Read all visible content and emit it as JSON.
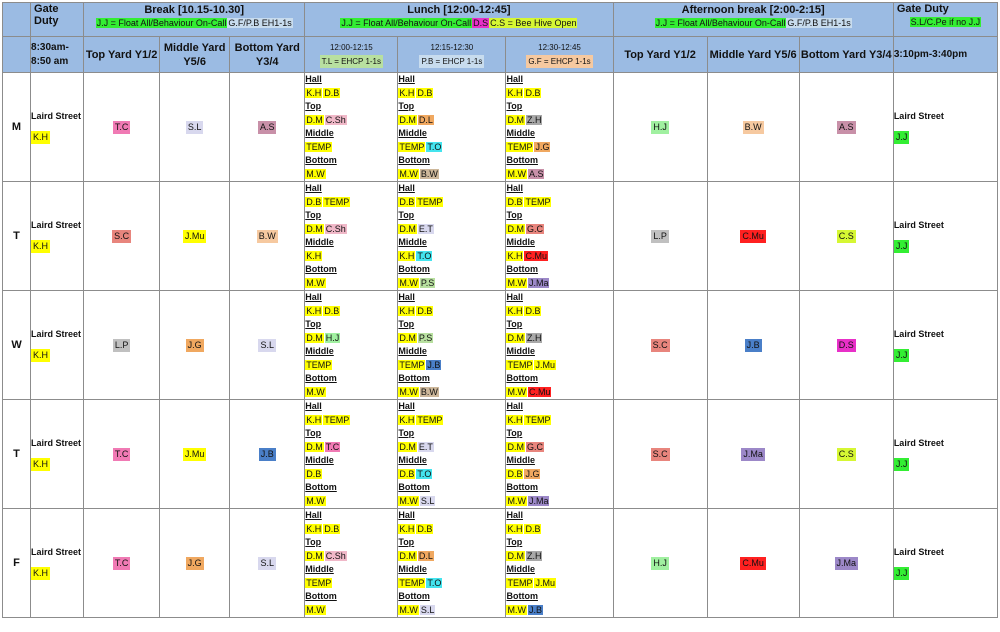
{
  "header": {
    "gate_duty_left": "Gate Duty",
    "break_title": "Break [10.15-10.30]",
    "break_notes": [
      {
        "text": "J.J = Float All/Behaviour On-Call",
        "color": "green"
      },
      {
        "text": "G.F/P.B EH1-1s",
        "color": "lblue"
      }
    ],
    "lunch_title": "Lunch [12:00-12:45]",
    "lunch_notes": [
      {
        "text": "J.J = Float All/Behaviour On-Call",
        "color": "green"
      },
      {
        "text": "D.S",
        "color": "magenta"
      },
      {
        "text": "C.S = Bee Hive Open",
        "color": "lime"
      }
    ],
    "afternoon_title": "Afternoon break [2:00-2:15]",
    "afternoon_notes": [
      {
        "text": "J.J = Float All/Behaviour On-Call",
        "color": "green"
      },
      {
        "text": "G.F/P.B EH1-1s",
        "color": "lblue"
      }
    ],
    "gate_duty_right": "Gate Duty",
    "gate_right_note": {
      "text": "S.L/C.Pe if no J.J",
      "color": "green"
    }
  },
  "subheader": {
    "morning_time": "8:30am-8:50 am",
    "break_yards": [
      "Top Yard Y1/2",
      "Middle Yard Y5/6",
      "Bottom Yard Y3/4"
    ],
    "lunch_slots": [
      {
        "time": "12:00-12:15",
        "note": "T.L = EHCP 1-1s",
        "color": "green2"
      },
      {
        "time": "12:15-12:30",
        "note": "P.B = EHCP 1-1s",
        "color": "lblue"
      },
      {
        "time": "12:30-12:45",
        "note": "G.F = EHCP 1-1s",
        "color": "peach"
      }
    ],
    "afternoon_yards": [
      "Top Yard Y1/2",
      "Middle Yard Y5/6",
      "Bottom Yard Y3/4"
    ],
    "afternoon_time": "3:10pm-3:40pm"
  },
  "days": [
    {
      "label": "M",
      "gate_am": {
        "place": "Laird Street",
        "staff": "K.H"
      },
      "break": [
        {
          "t": "T.C",
          "c": "pink"
        },
        {
          "t": "S.L",
          "c": "lav"
        },
        {
          "t": "A.S",
          "c": "mauve"
        }
      ],
      "lunch": [
        {
          "hall": [
            {
              "t": "K.H",
              "c": "yellow"
            },
            {
              "t": "D.B",
              "c": "yellow"
            }
          ],
          "top": [
            {
              "t": "D.M",
              "c": "yellow"
            },
            {
              "t": "C.Sh",
              "c": "rose"
            }
          ],
          "middle": [
            {
              "t": "TEMP",
              "c": "yellow"
            }
          ],
          "bottom": [
            {
              "t": "M.W",
              "c": "yellow"
            }
          ]
        },
        {
          "hall": [
            {
              "t": "K.H",
              "c": "yellow"
            },
            {
              "t": "D.B",
              "c": "yellow"
            }
          ],
          "top": [
            {
              "t": "D.M",
              "c": "yellow"
            },
            {
              "t": "D.L",
              "c": "orange"
            }
          ],
          "middle": [
            {
              "t": "TEMP",
              "c": "yellow"
            },
            {
              "t": "T.O",
              "c": "cyan"
            }
          ],
          "bottom": [
            {
              "t": "M.W",
              "c": "yellow"
            },
            {
              "t": "B.W",
              "c": "tan"
            }
          ]
        },
        {
          "hall": [
            {
              "t": "K.H",
              "c": "yellow"
            },
            {
              "t": "D.B",
              "c": "yellow"
            }
          ],
          "top": [
            {
              "t": "D.M",
              "c": "yellow"
            },
            {
              "t": "Z.H",
              "c": "dgray"
            }
          ],
          "middle": [
            {
              "t": "TEMP",
              "c": "yellow"
            },
            {
              "t": "J.G",
              "c": "orange"
            }
          ],
          "bottom": [
            {
              "t": "M.W",
              "c": "yellow"
            },
            {
              "t": "A.S",
              "c": "mauve"
            }
          ]
        }
      ],
      "afternoon": [
        {
          "t": "H.J",
          "c": "lightgreen"
        },
        {
          "t": "B.W",
          "c": "peach"
        },
        {
          "t": "A.S",
          "c": "mauve"
        }
      ],
      "gate_pm": {
        "place": "Laird Street",
        "staff": "J.J"
      }
    },
    {
      "label": "T",
      "gate_am": {
        "place": "Laird Street",
        "staff": "K.H"
      },
      "break": [
        {
          "t": "S.C",
          "c": "salmon"
        },
        {
          "t": "J.Mu",
          "c": "yellow"
        },
        {
          "t": "B.W",
          "c": "peach"
        }
      ],
      "lunch": [
        {
          "hall": [
            {
              "t": "D.B",
              "c": "yellow"
            },
            {
              "t": "TEMP",
              "c": "yellow"
            }
          ],
          "top": [
            {
              "t": "D.M",
              "c": "yellow"
            },
            {
              "t": "C.Sh",
              "c": "rose"
            }
          ],
          "middle": [
            {
              "t": "K.H",
              "c": "yellow"
            }
          ],
          "bottom": [
            {
              "t": "M.W",
              "c": "yellow"
            }
          ]
        },
        {
          "hall": [
            {
              "t": "D.B",
              "c": "yellow"
            },
            {
              "t": "TEMP",
              "c": "yellow"
            }
          ],
          "top": [
            {
              "t": "D.M",
              "c": "yellow"
            },
            {
              "t": "E.T",
              "c": "lav"
            }
          ],
          "middle": [
            {
              "t": "K.H",
              "c": "yellow"
            },
            {
              "t": "T.O",
              "c": "cyan"
            }
          ],
          "bottom": [
            {
              "t": "M.W",
              "c": "yellow"
            },
            {
              "t": "P.S",
              "c": "green2"
            }
          ]
        },
        {
          "hall": [
            {
              "t": "D.B",
              "c": "yellow"
            },
            {
              "t": "TEMP",
              "c": "yellow"
            }
          ],
          "top": [
            {
              "t": "D.M",
              "c": "yellow"
            },
            {
              "t": "G.C",
              "c": "salmon"
            }
          ],
          "middle": [
            {
              "t": "K.H",
              "c": "yellow"
            },
            {
              "t": "C.Mu",
              "c": "red"
            }
          ],
          "bottom": [
            {
              "t": "M.W",
              "c": "yellow"
            },
            {
              "t": "J.Ma",
              "c": "purple"
            }
          ]
        }
      ],
      "afternoon": [
        {
          "t": "L.P",
          "c": "gray"
        },
        {
          "t": "C.Mu",
          "c": "red"
        },
        {
          "t": "C.S",
          "c": "lime"
        }
      ],
      "gate_pm": {
        "place": "Laird Street",
        "staff": "J.J"
      }
    },
    {
      "label": "W",
      "gate_am": {
        "place": "Laird Street",
        "staff": "K.H"
      },
      "break": [
        {
          "t": "L.P",
          "c": "gray"
        },
        {
          "t": "J.G",
          "c": "orange"
        },
        {
          "t": "S.L",
          "c": "lav"
        }
      ],
      "lunch": [
        {
          "hall": [
            {
              "t": "K.H",
              "c": "yellow"
            },
            {
              "t": "D.B",
              "c": "yellow"
            }
          ],
          "top": [
            {
              "t": "D.M",
              "c": "yellow"
            },
            {
              "t": "H.J",
              "c": "lightgreen"
            }
          ],
          "middle": [
            {
              "t": "TEMP",
              "c": "yellow"
            }
          ],
          "bottom": [
            {
              "t": "M.W",
              "c": "yellow"
            }
          ]
        },
        {
          "hall": [
            {
              "t": "K.H",
              "c": "yellow"
            },
            {
              "t": "D.B",
              "c": "yellow"
            }
          ],
          "top": [
            {
              "t": "D.M",
              "c": "yellow"
            },
            {
              "t": "P.S",
              "c": "green2"
            }
          ],
          "middle": [
            {
              "t": "TEMP",
              "c": "yellow"
            },
            {
              "t": "J.B",
              "c": "blue"
            }
          ],
          "bottom": [
            {
              "t": "M.W",
              "c": "yellow"
            },
            {
              "t": "B.W",
              "c": "tan"
            }
          ]
        },
        {
          "hall": [
            {
              "t": "K.H",
              "c": "yellow"
            },
            {
              "t": "D.B",
              "c": "yellow"
            }
          ],
          "top": [
            {
              "t": "D.M",
              "c": "yellow"
            },
            {
              "t": "Z.H",
              "c": "dgray"
            }
          ],
          "middle": [
            {
              "t": "TEMP",
              "c": "yellow"
            },
            {
              "t": "J.Mu",
              "c": "yellow"
            }
          ],
          "bottom": [
            {
              "t": "M.W",
              "c": "yellow"
            },
            {
              "t": "C.Mu",
              "c": "red"
            }
          ]
        }
      ],
      "afternoon": [
        {
          "t": "S.C",
          "c": "salmon"
        },
        {
          "t": "J.B",
          "c": "blue"
        },
        {
          "t": "D.S",
          "c": "magenta"
        }
      ],
      "gate_pm": {
        "place": "Laird Street",
        "staff": "J.J"
      }
    },
    {
      "label": "T",
      "gate_am": {
        "place": "Laird Street",
        "staff": "K.H"
      },
      "break": [
        {
          "t": "T.C",
          "c": "pink"
        },
        {
          "t": "J.Mu",
          "c": "yellow"
        },
        {
          "t": "J.B",
          "c": "blue"
        }
      ],
      "lunch": [
        {
          "hall": [
            {
              "t": "K.H",
              "c": "yellow"
            },
            {
              "t": "TEMP",
              "c": "yellow"
            }
          ],
          "top": [
            {
              "t": "D.M",
              "c": "yellow"
            },
            {
              "t": "T.C",
              "c": "pink"
            }
          ],
          "middle": [
            {
              "t": "D.B",
              "c": "yellow"
            }
          ],
          "bottom": [
            {
              "t": "M.W",
              "c": "yellow"
            }
          ]
        },
        {
          "hall": [
            {
              "t": "K.H",
              "c": "yellow"
            },
            {
              "t": "TEMP",
              "c": "yellow"
            }
          ],
          "top": [
            {
              "t": "D.M",
              "c": "yellow"
            },
            {
              "t": "E.T",
              "c": "lav"
            }
          ],
          "middle": [
            {
              "t": "D.B",
              "c": "yellow"
            },
            {
              "t": "T.O",
              "c": "cyan"
            }
          ],
          "bottom": [
            {
              "t": "M.W",
              "c": "yellow"
            },
            {
              "t": "S.L",
              "c": "lav"
            }
          ]
        },
        {
          "hall": [
            {
              "t": "K.H",
              "c": "yellow"
            },
            {
              "t": "TEMP",
              "c": "yellow"
            }
          ],
          "top": [
            {
              "t": "D.M",
              "c": "yellow"
            },
            {
              "t": "G.C",
              "c": "salmon"
            }
          ],
          "middle": [
            {
              "t": "D.B",
              "c": "yellow"
            },
            {
              "t": "J.G",
              "c": "orange"
            }
          ],
          "bottom": [
            {
              "t": "M.W",
              "c": "yellow"
            },
            {
              "t": "J.Ma",
              "c": "purple"
            }
          ]
        }
      ],
      "afternoon": [
        {
          "t": "S.C",
          "c": "salmon"
        },
        {
          "t": "J.Ma",
          "c": "purple"
        },
        {
          "t": "C.S",
          "c": "lime"
        }
      ],
      "gate_pm": {
        "place": "Laird Street",
        "staff": "J.J"
      }
    },
    {
      "label": "F",
      "gate_am": {
        "place": "Laird Street",
        "staff": "K.H"
      },
      "break": [
        {
          "t": "T.C",
          "c": "pink"
        },
        {
          "t": "J.G",
          "c": "orange"
        },
        {
          "t": "S.L",
          "c": "lav"
        }
      ],
      "lunch": [
        {
          "hall": [
            {
              "t": "K.H",
              "c": "yellow"
            },
            {
              "t": "D.B",
              "c": "yellow"
            }
          ],
          "top": [
            {
              "t": "D.M",
              "c": "yellow"
            },
            {
              "t": "C.Sh",
              "c": "rose"
            }
          ],
          "middle": [
            {
              "t": "TEMP",
              "c": "yellow"
            }
          ],
          "bottom": [
            {
              "t": "M.W",
              "c": "yellow"
            }
          ]
        },
        {
          "hall": [
            {
              "t": "K.H",
              "c": "yellow"
            },
            {
              "t": "D.B",
              "c": "yellow"
            }
          ],
          "top": [
            {
              "t": "D.M",
              "c": "yellow"
            },
            {
              "t": "D.L",
              "c": "orange"
            }
          ],
          "middle": [
            {
              "t": "TEMP",
              "c": "yellow"
            },
            {
              "t": "T.O",
              "c": "cyan"
            }
          ],
          "bottom": [
            {
              "t": "M.W",
              "c": "yellow"
            },
            {
              "t": "S.L",
              "c": "lav"
            }
          ]
        },
        {
          "hall": [
            {
              "t": "K.H",
              "c": "yellow"
            },
            {
              "t": "D.B",
              "c": "yellow"
            }
          ],
          "top": [
            {
              "t": "D.M",
              "c": "yellow"
            },
            {
              "t": "Z.H",
              "c": "dgray"
            }
          ],
          "middle": [
            {
              "t": "TEMP",
              "c": "yellow"
            },
            {
              "t": "J.Mu",
              "c": "yellow"
            }
          ],
          "bottom": [
            {
              "t": "M.W",
              "c": "yellow"
            },
            {
              "t": "J.B",
              "c": "blue"
            }
          ]
        }
      ],
      "afternoon": [
        {
          "t": "H.J",
          "c": "lightgreen"
        },
        {
          "t": "C.Mu",
          "c": "red"
        },
        {
          "t": "J.Ma",
          "c": "purple"
        }
      ],
      "gate_pm": {
        "place": "Laird Street",
        "staff": "J.J"
      }
    }
  ],
  "lunch_area_labels": {
    "hall": "Hall",
    "top": "Top",
    "middle": "Middle",
    "bottom": "Bottom"
  }
}
